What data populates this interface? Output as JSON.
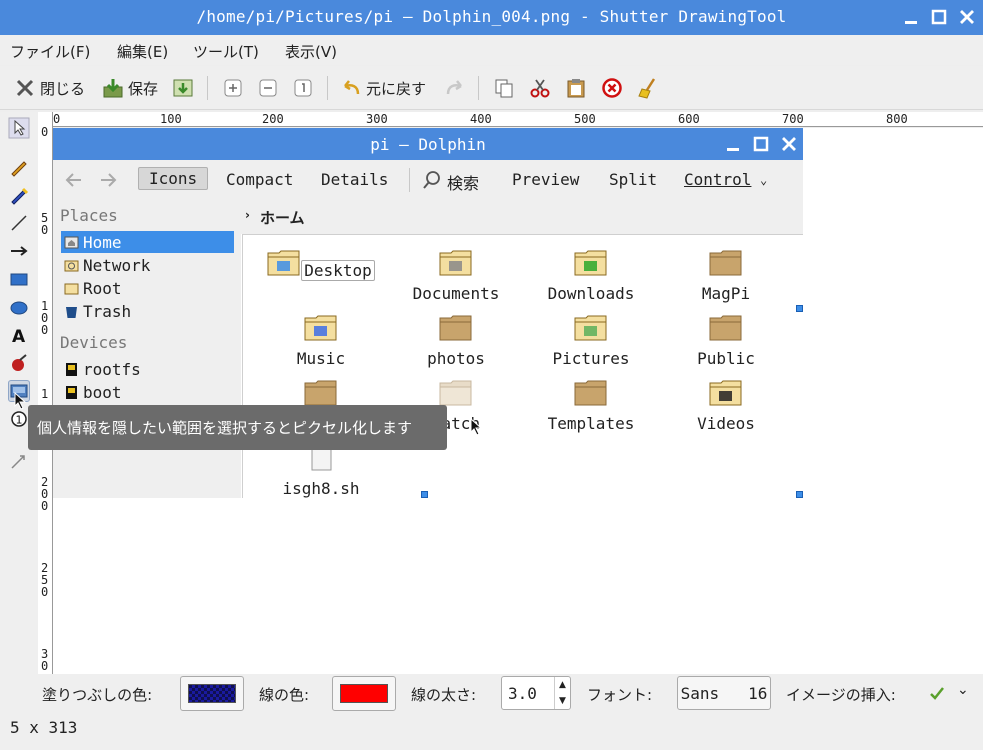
{
  "window": {
    "title": "/home/pi/Pictures/pi — Dolphin_004.png - Shutter DrawingTool"
  },
  "menu": [
    "ファイル(F)",
    "編集(E)",
    "ツール(T)",
    "表示(V)"
  ],
  "toolbar": {
    "close_label": "閉じる",
    "save_label": "保存",
    "undo_label": "元に戻す"
  },
  "ruler": {
    "h_labels": [
      "0",
      "100",
      "200",
      "300",
      "400",
      "500",
      "600",
      "700",
      "800"
    ],
    "v_labels": [
      "0",
      "5\n0",
      "1\n0\n0",
      "1",
      "2\n0\n0",
      "2\n5\n0",
      "3\n0"
    ]
  },
  "dolphin": {
    "title": "pi — Dolphin",
    "view_modes": [
      "Icons",
      "Compact",
      "Details"
    ],
    "search_label": "検索",
    "preview_label": "Preview",
    "split_label": "Split",
    "control_label": "Control",
    "places_heading": "Places",
    "places": [
      "Home",
      "Network",
      "Root",
      "Trash"
    ],
    "devices_heading": "Devices",
    "devices": [
      "rootfs",
      "boot"
    ],
    "breadcrumb": "ホーム",
    "files": [
      {
        "name": "Desktop",
        "icon": "folder-desktop-icon"
      },
      {
        "name": "Documents",
        "icon": "folder-documents-icon"
      },
      {
        "name": "Downloads",
        "icon": "folder-downloads-icon"
      },
      {
        "name": "MagPi",
        "icon": "folder-icon"
      },
      {
        "name": "Music",
        "icon": "folder-music-icon"
      },
      {
        "name": "photos",
        "icon": "folder-icon"
      },
      {
        "name": "Pictures",
        "icon": "folder-pictures-icon"
      },
      {
        "name": "Public",
        "icon": "folder-icon"
      },
      {
        "name": "",
        "icon": "folder-icon"
      },
      {
        "name": "ratch",
        "icon": "folder-icon"
      },
      {
        "name": "Templates",
        "icon": "folder-icon"
      },
      {
        "name": "Videos",
        "icon": "folder-videos-icon"
      },
      {
        "name": "isgh8.sh",
        "icon": "script-file-icon"
      }
    ]
  },
  "tooltip": "個人情報を隠したい範囲を選択するとピクセル化します",
  "bottombar": {
    "fill_color_label": "塗りつぶしの色:",
    "fill_color": "#1a1aa0",
    "line_color_label": "線の色:",
    "line_color": "#ff0000",
    "line_width_label": "線の太さ:",
    "line_width": "3.0",
    "font_label": "フォント:",
    "font_value": "Sans   16",
    "insert_image_label": "イメージの挿入:"
  },
  "status": "5 x 313"
}
